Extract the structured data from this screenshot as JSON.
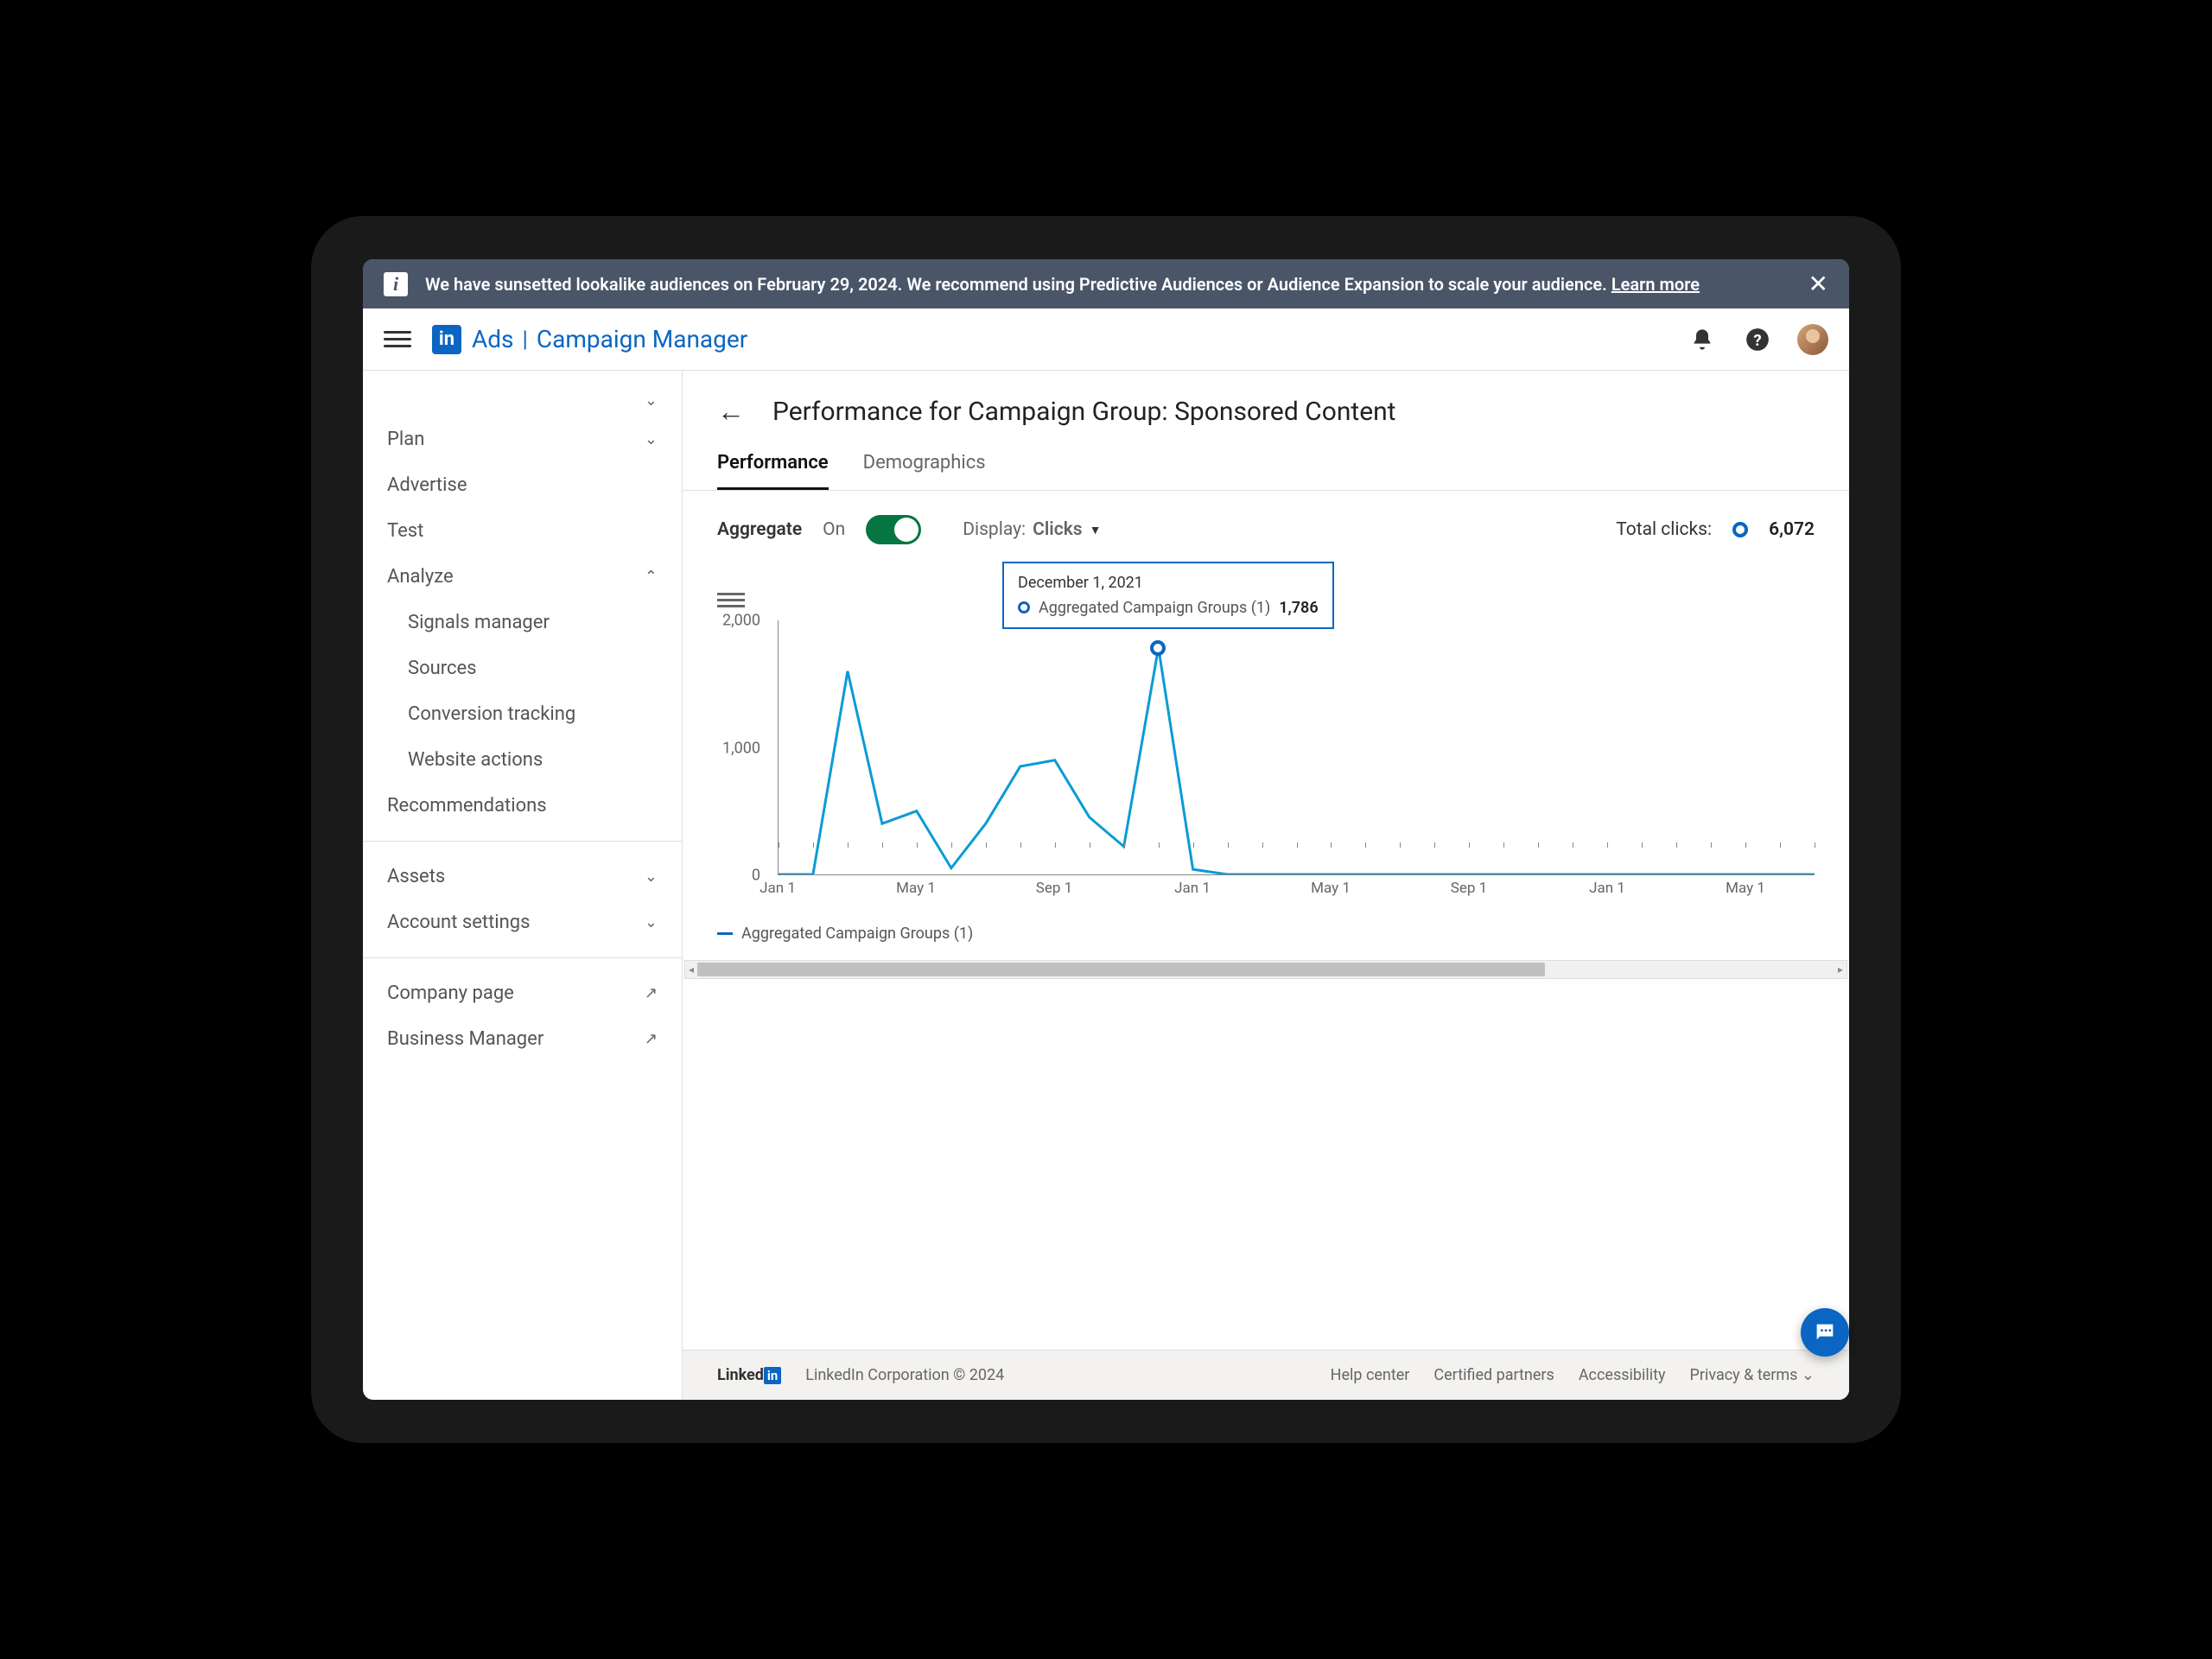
{
  "banner": {
    "text": "We have sunsetted lookalike audiences on February 29, 2024. We recommend using Predictive Audiences or Audience Expansion to scale your audience. ",
    "link": "Learn more"
  },
  "topbar": {
    "brand_ads": "Ads",
    "brand_cm": "Campaign Manager"
  },
  "sidebar": {
    "plan": "Plan",
    "advertise": "Advertise",
    "test": "Test",
    "analyze": "Analyze",
    "analyze_children": {
      "signals": "Signals manager",
      "sources": "Sources",
      "conversion": "Conversion tracking",
      "website": "Website actions"
    },
    "recommendations": "Recommendations",
    "assets": "Assets",
    "account": "Account settings",
    "company": "Company page",
    "business": "Business Manager"
  },
  "page": {
    "title": "Performance for Campaign Group: Sponsored Content",
    "tabs": {
      "performance": "Performance",
      "demographics": "Demographics"
    }
  },
  "controls": {
    "aggregate": "Aggregate",
    "on": "On",
    "display": "Display:",
    "display_value": "Clicks",
    "total_label": "Total clicks:",
    "total_value": "6,072"
  },
  "tooltip": {
    "date": "December 1, 2021",
    "series": "Aggregated Campaign Groups (1)",
    "value": "1,786"
  },
  "legend": {
    "series": "Aggregated Campaign Groups (1)"
  },
  "footer": {
    "corp": "LinkedIn Corporation © 2024",
    "help": "Help center",
    "partners": "Certified partners",
    "accessibility": "Accessibility",
    "privacy": "Privacy & terms"
  },
  "chart_data": {
    "type": "line",
    "title": "Performance for Campaign Group: Sponsored Content",
    "xlabel": "",
    "ylabel": "",
    "ylim": [
      0,
      2000
    ],
    "y_ticks": [
      0,
      1000,
      2000
    ],
    "x_tick_labels": [
      "Jan 1",
      "May 1",
      "Sep 1",
      "Jan 1",
      "May 1",
      "Sep 1",
      "Jan 1",
      "May 1"
    ],
    "series": [
      {
        "name": "Aggregated Campaign Groups (1)",
        "x": [
          "2021-01-01",
          "2021-02-01",
          "2021-03-01",
          "2021-04-01",
          "2021-05-01",
          "2021-06-01",
          "2021-07-01",
          "2021-08-01",
          "2021-09-01",
          "2021-10-01",
          "2021-11-01",
          "2021-12-01",
          "2022-01-01",
          "2022-02-01",
          "2022-03-01",
          "2022-04-01",
          "2022-05-01",
          "2022-06-01",
          "2022-07-01",
          "2022-08-01",
          "2022-09-01",
          "2022-10-01",
          "2022-11-01",
          "2022-12-01",
          "2023-01-01",
          "2023-02-01",
          "2023-03-01",
          "2023-04-01",
          "2023-05-01",
          "2023-06-01",
          "2023-07-01"
        ],
        "values": [
          0,
          0,
          1600,
          400,
          500,
          50,
          400,
          850,
          900,
          450,
          220,
          1786,
          40,
          0,
          0,
          0,
          0,
          0,
          0,
          0,
          0,
          0,
          0,
          0,
          0,
          0,
          0,
          0,
          0,
          0,
          0
        ]
      }
    ],
    "highlight": {
      "x": "2021-12-01",
      "value": 1786
    }
  }
}
